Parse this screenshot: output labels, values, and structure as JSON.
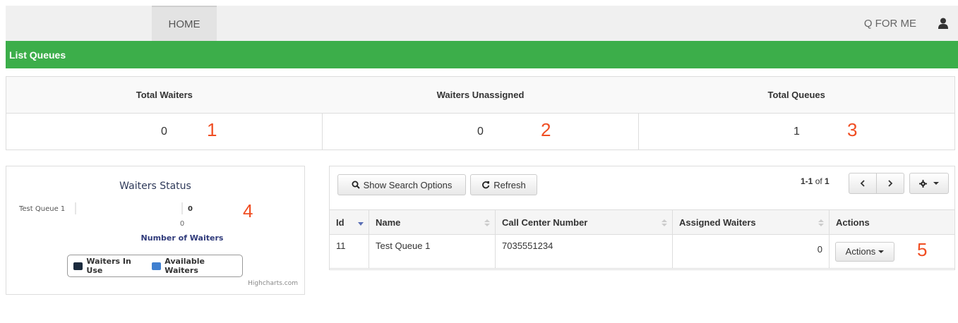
{
  "nav": {
    "home_label": "HOME",
    "app_label": "Q FOR ME",
    "user_icon": "user-icon"
  },
  "header": {
    "title": "List Queues",
    "color": "#3cae4a"
  },
  "stats": {
    "headers": [
      "Total Waiters",
      "Waiters Unassigned",
      "Total Queues"
    ],
    "values": [
      "0",
      "0",
      "1"
    ],
    "annotations": [
      "1",
      "2",
      "3"
    ]
  },
  "chart": {
    "title": "Waiters Status",
    "credits": "Highcharts.com",
    "annotation": "4"
  },
  "chart_data": {
    "type": "bar",
    "title": "Waiters Status",
    "categories": [
      "Test Queue 1"
    ],
    "series": [
      {
        "name": "Waiters In Use",
        "values": [
          0
        ],
        "color": "#1b2a3d"
      },
      {
        "name": "Available Waiters",
        "values": [
          0
        ],
        "color": "#4080d0"
      }
    ],
    "data_labels": [
      "0"
    ],
    "ylabel": "Number of Waiters",
    "y_ticks": [
      "0"
    ],
    "legend_position": "bottom"
  },
  "toolbar": {
    "search_label": "Show Search Options",
    "refresh_label": "Refresh",
    "pager_range": "1-1",
    "pager_of": "of",
    "pager_total": "1"
  },
  "table": {
    "columns": [
      "Id",
      "Name",
      "Call Center Number",
      "Assigned Waiters",
      "Actions"
    ],
    "rows": [
      {
        "id": "11",
        "name": "Test Queue 1",
        "number": "7035551234",
        "assigned": "0",
        "action_label": "Actions"
      }
    ],
    "annotation": "5"
  },
  "colors": {
    "annotation": "#f04e23",
    "header_green": "#3cae4a"
  }
}
